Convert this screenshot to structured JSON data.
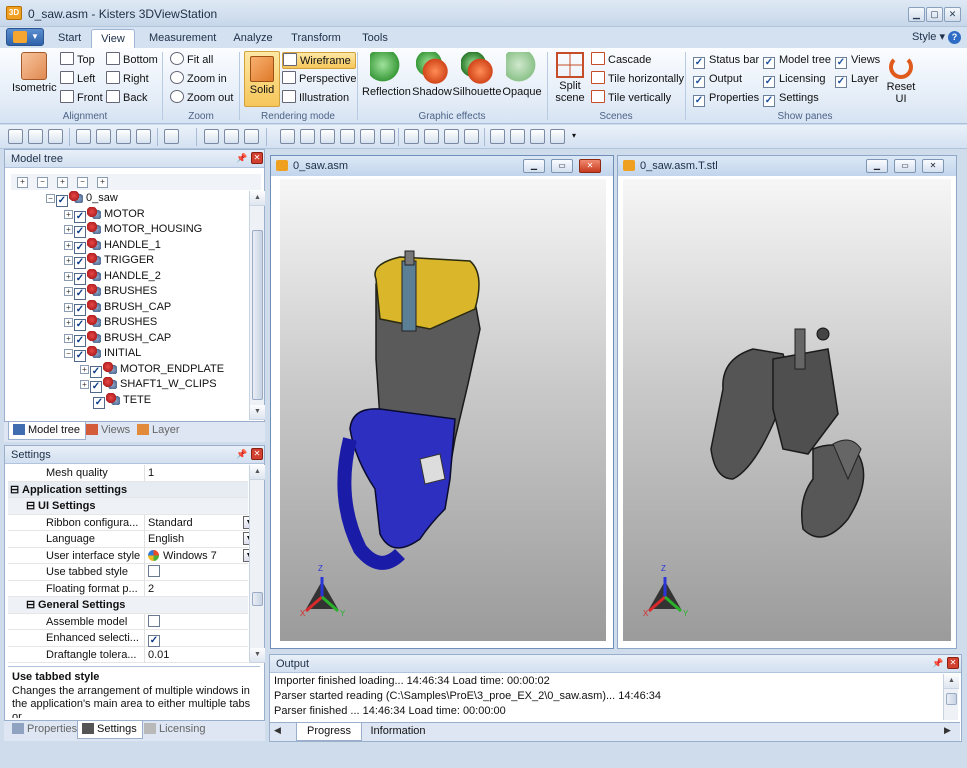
{
  "window": {
    "title": "0_saw.asm - Kisters 3DViewStation",
    "app_icon_text": "3D"
  },
  "ribbon_tabs": [
    "Start",
    "View",
    "Measurement",
    "Analyze",
    "Transform",
    "Tools"
  ],
  "active_tab": "View",
  "style_label": "Style",
  "groups": {
    "alignment": {
      "label": "Alignment",
      "isometric": "Isometric",
      "top": "Top",
      "left": "Left",
      "front": "Front",
      "bottom": "Bottom",
      "right": "Right",
      "back": "Back"
    },
    "zoom": {
      "label": "Zoom",
      "fit_all": "Fit all",
      "zoom_in": "Zoom in",
      "zoom_out": "Zoom out"
    },
    "rendering": {
      "label": "Rendering mode",
      "solid": "Solid",
      "wireframe": "Wireframe",
      "perspective": "Perspective",
      "illustration": "Illustration"
    },
    "effects": {
      "label": "Graphic effects",
      "reflection": "Reflection",
      "shadow": "Shadow",
      "silhouette": "Silhouette",
      "opaque": "Opaque"
    },
    "scenes": {
      "label": "Scenes",
      "split_scene_1": "Split",
      "split_scene_2": "scene",
      "cascade": "Cascade",
      "tile_h": "Tile horizontally",
      "tile_v": "Tile vertically"
    },
    "show_panes": {
      "label": "Show panes",
      "status_bar": "Status bar",
      "output": "Output",
      "properties": "Properties",
      "model_tree": "Model tree",
      "licensing": "Licensing",
      "settings": "Settings",
      "views": "Views",
      "layer": "Layer",
      "reset_ui_1": "Reset",
      "reset_ui_2": "UI"
    }
  },
  "model_tree": {
    "title": "Model tree",
    "root": "0_saw",
    "items": [
      "MOTOR",
      "MOTOR_HOUSING",
      "HANDLE_1",
      "TRIGGER",
      "HANDLE_2",
      "BRUSHES",
      "BRUSH_CAP",
      "BRUSHES",
      "BRUSH_CAP",
      "INITIAL"
    ],
    "children": [
      "MOTOR_ENDPLATE",
      "SHAFT1_W_CLIPS",
      "TETE"
    ],
    "tabs": [
      "Model tree",
      "Views",
      "Layer"
    ]
  },
  "settings": {
    "title": "Settings",
    "mesh_quality": {
      "key": "Mesh quality",
      "value": "1"
    },
    "app_settings": "Application settings",
    "ui_settings": "UI Settings",
    "ribbon_config": {
      "key": "Ribbon configura...",
      "value": "Standard"
    },
    "language": {
      "key": "Language",
      "value": "English"
    },
    "ui_style": {
      "key": "User interface style",
      "value": "Windows 7"
    },
    "tabbed_style": {
      "key": "Use tabbed style"
    },
    "float_format": {
      "key": "Floating format p...",
      "value": "2"
    },
    "general_settings": "General Settings",
    "assemble_model": {
      "key": "Assemble model"
    },
    "enhanced_sel": {
      "key": "Enhanced selecti..."
    },
    "draftangle": {
      "key": "Draftangle tolera...",
      "value": "0.01"
    },
    "desc_title": "Use tabbed style",
    "desc_text": "Changes the arrangement of multiple windows in the application's main area to either multiple tabs or",
    "tabs": [
      "Properties",
      "Settings",
      "Licensing"
    ]
  },
  "viewport_left": {
    "title": "0_saw.asm"
  },
  "viewport_right": {
    "title": "0_saw.asm.T.stl"
  },
  "axis_labels": {
    "z": "Z",
    "x": "X",
    "y": "Y"
  },
  "output": {
    "title": "Output",
    "lines": [
      "Importer finished loading... 14:46:34 Load time: 00:00:02",
      "Parser started reading (C:\\Samples\\ProE\\3_proe_EX_2\\0_saw.asm)... 14:46:34",
      "Parser finished ... 14:46:34 Load time: 00:00:00"
    ],
    "tabs": [
      "Progress",
      "Information"
    ]
  }
}
